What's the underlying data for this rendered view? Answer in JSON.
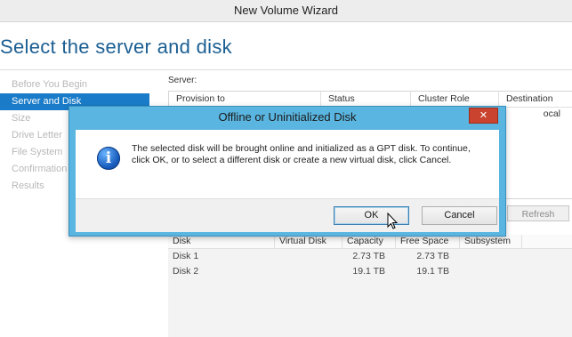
{
  "window": {
    "title": "New Volume Wizard"
  },
  "page": {
    "heading": "Select the server and disk"
  },
  "steps": [
    {
      "label": "Before You Begin",
      "active": false
    },
    {
      "label": "Server and Disk",
      "active": true
    },
    {
      "label": "Size",
      "active": false
    },
    {
      "label": "Drive Letter",
      "active": false
    },
    {
      "label": "File System",
      "active": false
    },
    {
      "label": "Confirmation",
      "active": false
    },
    {
      "label": "Results",
      "active": false
    }
  ],
  "server": {
    "label": "Server:",
    "columns": [
      "Provision to",
      "Status",
      "Cluster Role",
      "Destination"
    ],
    "visible_value": "ocal",
    "refresh_label": "Refresh"
  },
  "disk": {
    "columns": [
      "Disk",
      "Virtual Disk",
      "Capacity",
      "Free Space",
      "Subsystem"
    ],
    "rows": [
      {
        "disk": "Disk 1",
        "virtual_disk": "",
        "capacity": "2.73 TB",
        "free_space": "2.73 TB",
        "subsystem": ""
      },
      {
        "disk": "Disk 2",
        "virtual_disk": "",
        "capacity": "19.1 TB",
        "free_space": "19.1 TB",
        "subsystem": ""
      }
    ]
  },
  "dialog": {
    "title": "Offline or Uninitialized Disk",
    "close": "✕",
    "icon": "info-icon",
    "icon_glyph": "i",
    "message": "The selected disk will be brought online and initialized as a GPT disk. To continue, click OK, or to select a different disk or create a new virtual disk, click Cancel.",
    "ok_label": "OK",
    "cancel_label": "Cancel"
  },
  "colors": {
    "accent": "#1a7cc9",
    "heading": "#1b5f93",
    "dialog_frame": "#5ab6e0",
    "close_button": "#c9432e"
  }
}
